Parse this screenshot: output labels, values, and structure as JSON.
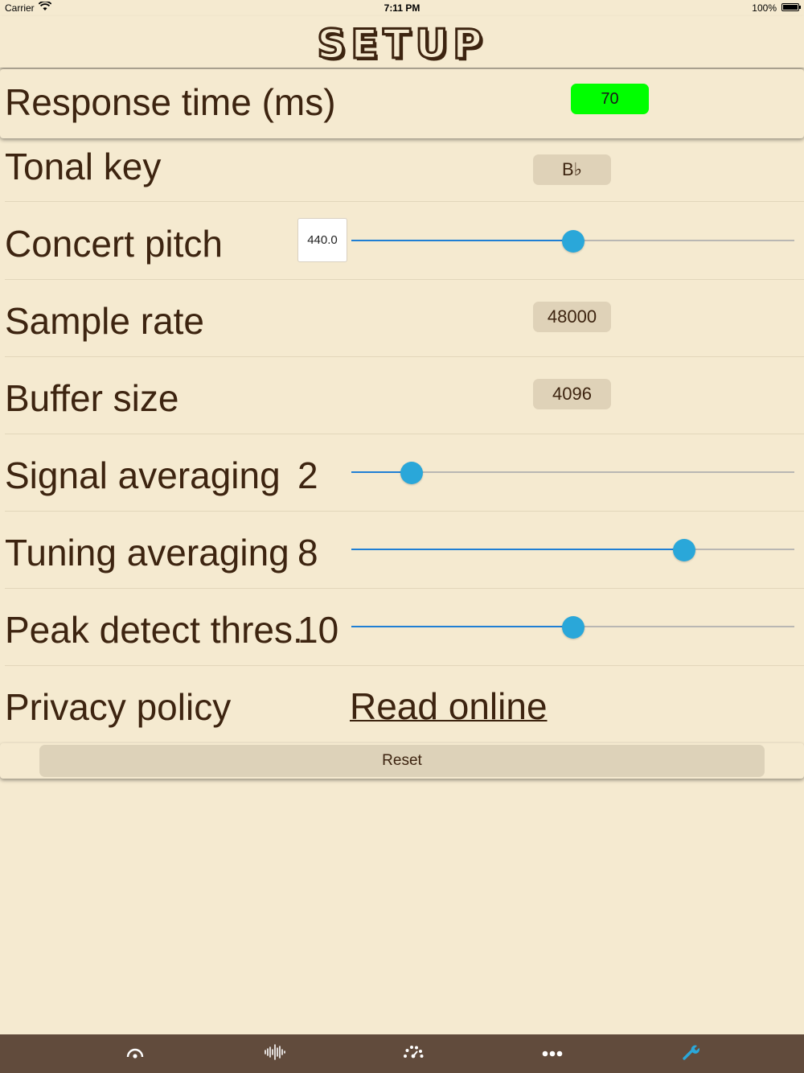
{
  "status_bar": {
    "carrier": "Carrier",
    "time": "7:11 PM",
    "battery": "100%",
    "battery_level": 1.0
  },
  "header": {
    "title": "SETUP"
  },
  "settings": {
    "response_time": {
      "label": "Response time (ms)",
      "value": "70"
    },
    "tonal_key": {
      "label": "Tonal key",
      "value": "B♭"
    },
    "concert_pitch": {
      "label": "Concert pitch",
      "value": "440.0",
      "slider_fraction": 0.5
    },
    "sample_rate": {
      "label": "Sample rate",
      "value": "48000"
    },
    "buffer_size": {
      "label": "Buffer size",
      "value": "4096"
    },
    "signal_averaging": {
      "label": "Signal averaging",
      "value": "2",
      "slider_fraction": 0.136
    },
    "tuning_averaging": {
      "label": "Tuning averaging",
      "value": "8",
      "slider_fraction": 0.751
    },
    "peak_detect": {
      "label": "Peak detect thres.",
      "value": "10",
      "slider_fraction": 0.5
    },
    "privacy_policy": {
      "label": "Privacy policy",
      "link_text": "Read online"
    }
  },
  "reset": {
    "label": "Reset"
  },
  "tab_bar": {
    "tabs": [
      {
        "icon": "tuner-gauge-icon",
        "active": false
      },
      {
        "icon": "waveform-icon",
        "active": false
      },
      {
        "icon": "dial-meter-icon",
        "active": false
      },
      {
        "icon": "more-icon",
        "active": false
      },
      {
        "icon": "wrench-icon",
        "active": true
      }
    ]
  },
  "colors": {
    "background": "#f5ead0",
    "text": "#3d2410",
    "response_badge": "#00ff00",
    "slider_thumb": "#2aa7d9",
    "slider_fill": "#1f7fd4",
    "tab_bar": "#614b3c",
    "tab_active": "#2aa7d9",
    "tab_inactive": "#ffffff"
  }
}
